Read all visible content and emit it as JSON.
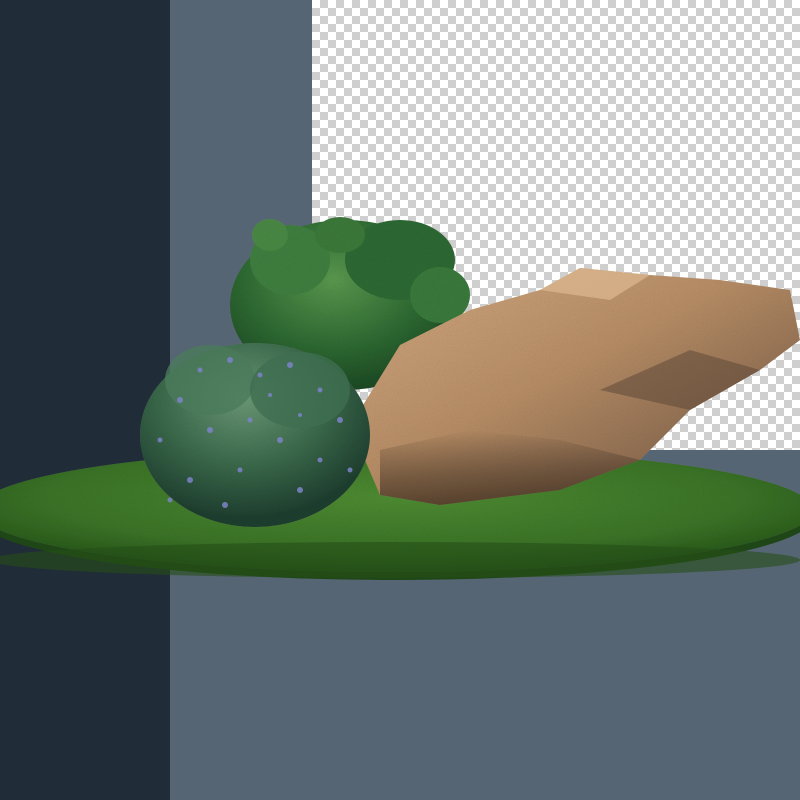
{
  "scene": {
    "subject": "grass-disc-with-shrubs-and-boulder",
    "transparent_background": true,
    "colors": {
      "left_panel": "#212c39",
      "mid_panel": "#566573",
      "checker_light": "#ffffff",
      "checker_dark": "#cfcfcf",
      "grass": "#3f7a2a",
      "grass_dark": "#2a5a1c",
      "shrub_green": "#3c7a3a",
      "shrub_blue_flowers": "#7d83c9",
      "rock_light": "#c79b70",
      "rock_shadow": "#6a5040"
    }
  }
}
